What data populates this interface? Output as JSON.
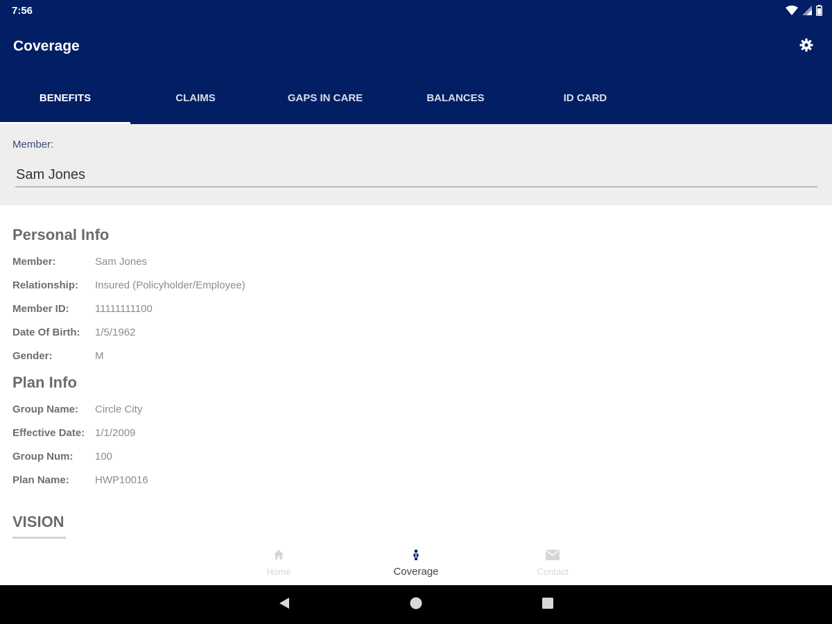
{
  "status_bar": {
    "time": "7:56"
  },
  "toolbar": {
    "title": "Coverage"
  },
  "tabs": [
    {
      "label": "BENEFITS",
      "active": true
    },
    {
      "label": "CLAIMS",
      "active": false
    },
    {
      "label": "GAPS IN CARE",
      "active": false
    },
    {
      "label": "BALANCES",
      "active": false
    },
    {
      "label": "ID CARD",
      "active": false
    }
  ],
  "member_selector": {
    "label": "Member:",
    "value": "Sam Jones"
  },
  "personal_info": {
    "title": "Personal Info",
    "rows": [
      {
        "label": "Member:",
        "value": "Sam Jones"
      },
      {
        "label": "Relationship:",
        "value": "Insured (Policyholder/Employee)"
      },
      {
        "label": "Member ID:",
        "value": "11111111100"
      },
      {
        "label": "Date Of Birth:",
        "value": "1/5/1962"
      },
      {
        "label": "Gender:",
        "value": "M"
      }
    ]
  },
  "plan_info": {
    "title": "Plan Info",
    "rows": [
      {
        "label": "Group Name:",
        "value": "Circle City"
      },
      {
        "label": "Effective Date:",
        "value": "1/1/2009"
      },
      {
        "label": "Group Num:",
        "value": "100"
      },
      {
        "label": "Plan Name:",
        "value": "HWP10016"
      }
    ]
  },
  "vision": {
    "title": "VISION"
  },
  "bottom_nav": [
    {
      "label": "Home",
      "icon": "home-icon",
      "active": false
    },
    {
      "label": "Coverage",
      "icon": "person-icon",
      "active": true
    },
    {
      "label": "Contact",
      "icon": "mail-icon",
      "active": false
    }
  ],
  "colors": {
    "app_bar": "#021e64",
    "member_section_bg": "#eeeeee",
    "text_label": "#6e6e6e",
    "text_value": "#8c8c8c",
    "nav_inactive": "#d6d6d6",
    "nav_active": "#444444"
  }
}
